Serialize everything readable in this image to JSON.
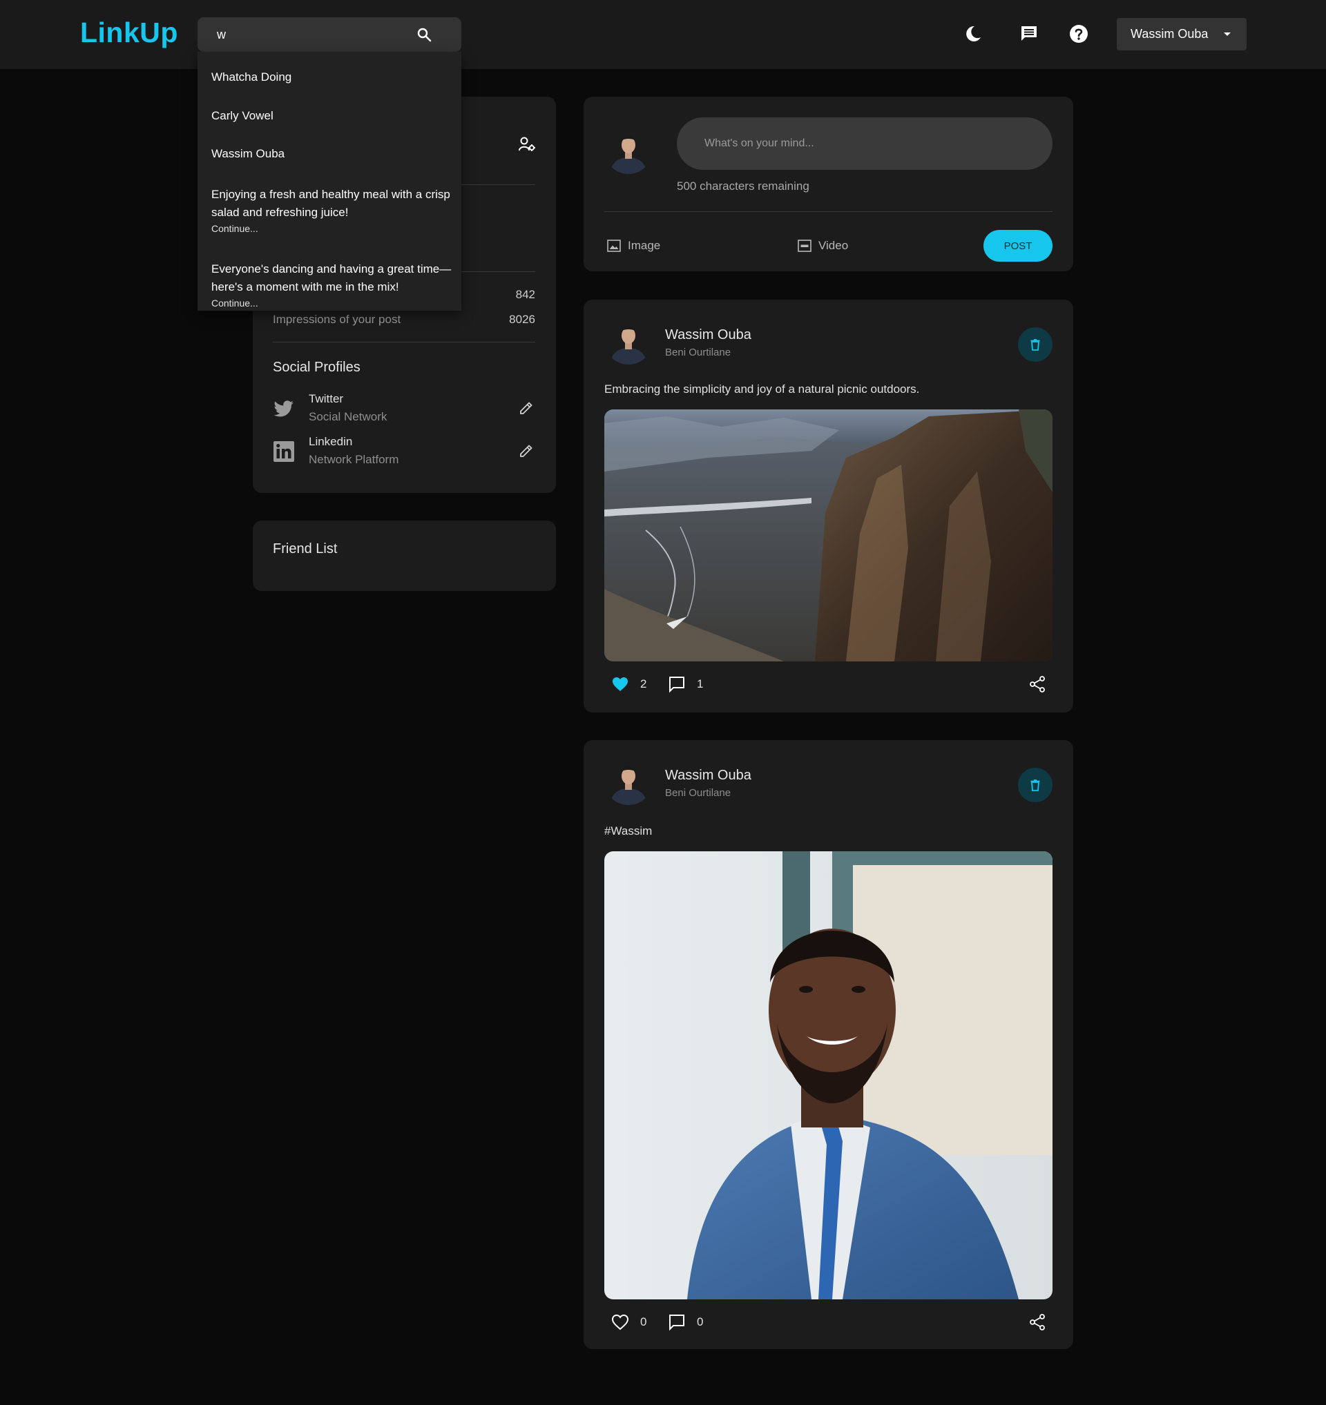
{
  "brand": {
    "logo": "LinkUp",
    "accent": "#16c6ec"
  },
  "search": {
    "value": "w",
    "suggestions": [
      {
        "text": "Whatcha Doing"
      },
      {
        "text": "Carly Vowel"
      },
      {
        "text": "Wassim Ouba"
      },
      {
        "text": "Enjoying a fresh and healthy meal with a crisp salad and refreshing juice!",
        "continue": "Continue..."
      },
      {
        "text": "Everyone's dancing and having a great time—here's a moment with me in the mix!",
        "continue": "Continue..."
      }
    ]
  },
  "navbar": {
    "icons": [
      "dark-mode-icon",
      "messages-icon",
      "help-icon"
    ],
    "user_menu_label": "Wassim Ouba"
  },
  "profile_card": {
    "stats": [
      {
        "label": "",
        "value": "842"
      },
      {
        "label": "Impressions of your post",
        "value": "8026"
      }
    ],
    "social_title": "Social Profiles",
    "social": [
      {
        "name": "Twitter",
        "sub": "Social Network",
        "icon": "twitter-icon"
      },
      {
        "name": "Linkedin",
        "sub": "Network Platform",
        "icon": "linkedin-icon"
      }
    ]
  },
  "friend_list": {
    "title": "Friend List"
  },
  "composer": {
    "placeholder": "What's on your mind...",
    "chars_remaining": "500 characters remaining",
    "image_label": "Image",
    "video_label": "Video",
    "post_label": "POST"
  },
  "posts": [
    {
      "author": "Wassim Ouba",
      "location": "Beni Ourtilane",
      "text": "Embracing the simplicity and joy of a natural picnic outdoors.",
      "likes": "2",
      "comments": "1",
      "liked": true
    },
    {
      "author": "Wassim Ouba",
      "location": "Beni Ourtilane",
      "text": "#Wassim",
      "likes": "0",
      "comments": "0",
      "liked": false
    }
  ]
}
